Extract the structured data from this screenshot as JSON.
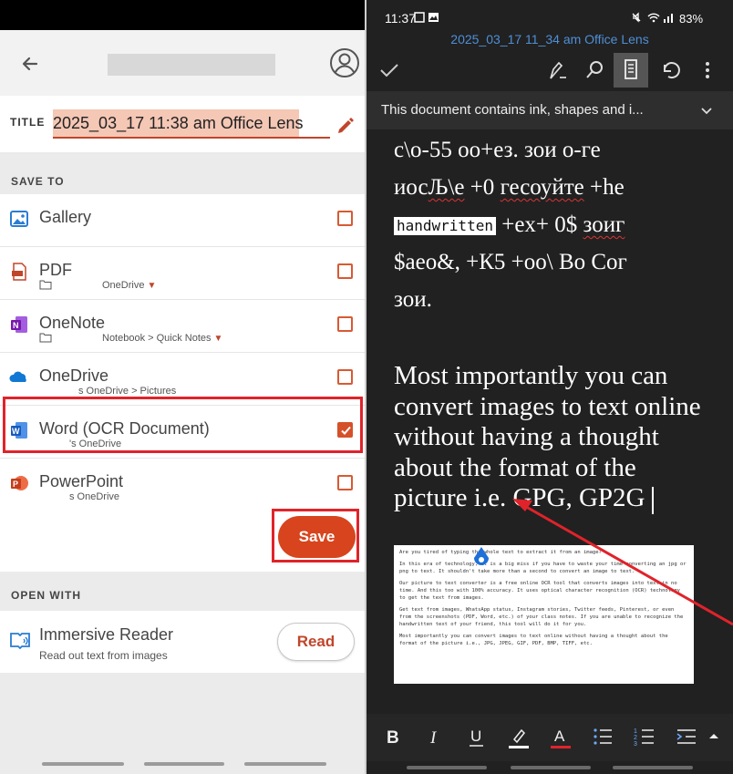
{
  "left": {
    "header": {
      "back_label": "Back",
      "profile_label": "Account"
    },
    "title": {
      "label": "TITLE",
      "value": "2025_03_17 11:38 am Office Lens"
    },
    "save_to": {
      "label": "SAVE TO",
      "items": [
        {
          "name": "Gallery",
          "sub": "",
          "checked": false
        },
        {
          "name": "PDF",
          "sub": "OneDrive",
          "checked": false
        },
        {
          "name": "OneNote",
          "sub": "Notebook > Quick Notes",
          "checked": false
        },
        {
          "name": "OneDrive",
          "sub": "s OneDrive > Pictures",
          "checked": false
        },
        {
          "name": "Word (OCR Document)",
          "sub": "'s OneDrive",
          "checked": true
        },
        {
          "name": "PowerPoint",
          "sub": "s OneDrive",
          "checked": false
        }
      ],
      "save_button": "Save"
    },
    "open_with": {
      "label": "OPEN WITH",
      "app_name": "Immersive Reader",
      "app_sub": "Read out text from images",
      "read_button": "Read"
    }
  },
  "right": {
    "status": {
      "time": "11:37",
      "battery": "83%"
    },
    "doc_title": "2025_03_17 11_34 am Office Lens",
    "banner": "This document contains ink, shapes and i...",
    "doc": {
      "cyr_1a": "c\\o-55 oo+ез. зои o-ге",
      "cyr_2a": "иос",
      "cyr_2b": "Љ\\е",
      "cyr_2c": " +0 ",
      "cyr_2d": "гесоуйте",
      "cyr_2e": " +he",
      "handwritten": "handwritten",
      "cyr_3": " +ex+ 0$ ",
      "cyr_3b": "зоиг",
      "cyr_4": "$аео&, +К5 +оо\\  Во Сог",
      "cyr_5": "зои.",
      "eng_paragraph": "Most importantly you can convert images to text online without having a thought about the format of the picture i.e. GPG, GP2G"
    },
    "ink_lines": [
      "Are you tired of typing the whole text to extract it from an image?",
      "In this era of technology, it is a big miss if you have to waste your time converting an jpg or png to text. It shouldn't take more than a second to convert an image to text.",
      "Our picture to text converter is a free online OCR tool that converts images into text in no time. And this too with 100% accuracy. It uses optical character recognition (OCR) technology to get the text from images.",
      "Get text from images, WhatsApp status, Instagram stories, Twitter feeds, Pinterest, or even from the screenshots (PDF, Word, etc.) of your class notes. If you are unable to recognize the handwritten text of your friend, this tool will do it for you.",
      "Most importantly you can convert images to text online without having a thought about the format of the picture i.e., JPG, JPEG, GIF, PDF, BMP, TIFF, etc."
    ],
    "colors": {
      "accent": "#d8441e",
      "link_blue": "#4e8fd6",
      "highlight_red": "#e0232a"
    }
  }
}
